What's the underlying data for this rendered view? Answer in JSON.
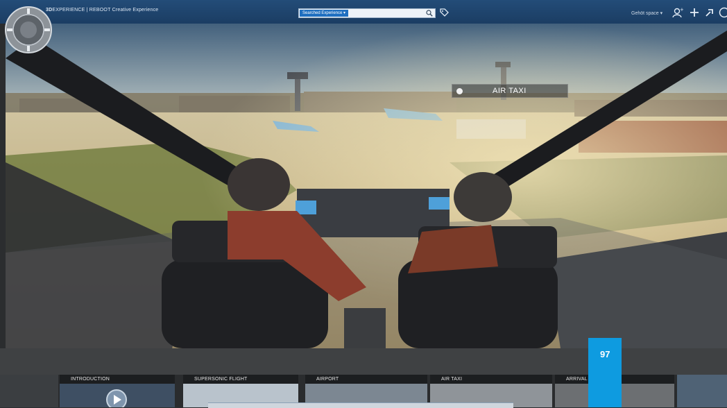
{
  "topbar": {
    "brand_bold": "3D",
    "brand_rest": "EXPERIENCE | REBOOT Creative Experience",
    "search_scope": "Searched Experience ▾",
    "search_value": "",
    "space_label": "Gehöt space ▾"
  },
  "scene": {
    "step_label": "AIR TAXI"
  },
  "chapters": [
    {
      "label": "INTRODUCTION"
    },
    {
      "label": "SUPERSONIC FLIGHT"
    },
    {
      "label": "AIRPORT"
    },
    {
      "label": "AIR TAXI"
    },
    {
      "label": "ARRIVAL"
    }
  ],
  "page": {
    "number": "97"
  },
  "colors": {
    "topbar": "#1b3d63",
    "accent": "#0e9be0",
    "sky": "#5f7f9b",
    "ground": "#c9b98c"
  },
  "icons": [
    "compass-icon",
    "search-icon",
    "tag-icon",
    "add-user-icon",
    "plus-icon",
    "share-icon",
    "help-icon",
    "play-icon"
  ]
}
